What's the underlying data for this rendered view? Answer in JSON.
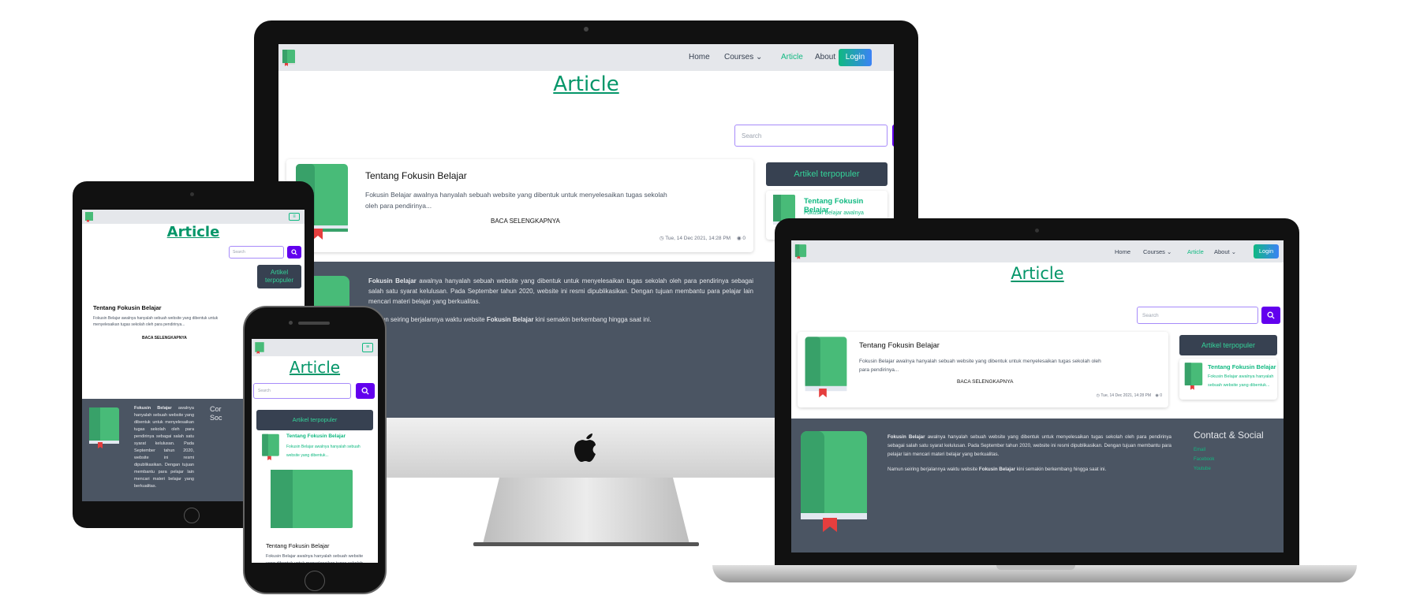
{
  "nav": {
    "home": "Home",
    "courses": "Courses",
    "article": "Article",
    "about": "About",
    "login": "Login"
  },
  "page_title": "Article",
  "search": {
    "placeholder": "Search"
  },
  "article_card": {
    "title": "Tentang Fokusin Belajar",
    "excerpt": "Fokusin Belajar awalnya hanyalah sebuah website yang dibentuk untuk menyelesaikan tugas sekolah oleh para pendirinya...",
    "read_more": "BACA SELENGKAPNYA",
    "date": "Tue, 14 Dec 2021, 14:28 PM",
    "views": "0"
  },
  "popular": {
    "heading": "Artikel terpopuler",
    "item_title": "Tentang Fokusin Belajar",
    "item_excerpt": "Fokusin Belajar awalnya hanyalah sebuah website yang dibentuk..."
  },
  "footer": {
    "brand": "Fokusin Belajar",
    "p1_rest": "awalnya hanyalah sebuah website yang dibentuk untuk menyelesaikan tugas sekolah oleh para pendirinya sebagai salah satu syarat kelulusan. Pada September tahun 2020, website ini resmi dipublikasikan. Dengan tujuan membantu para pelajar lain mencari materi belajar yang berkualitas.",
    "p2_start": "Namun seiring berjalannya waktu website",
    "p2_brand": "Fokusin Belajar",
    "p2_end": "kini semakin berkembang hingga saat ini.",
    "contact_title": "Contact & Social",
    "contact_title_short": "Cor Soc",
    "links": [
      "Email",
      "Facebook",
      "Youtube"
    ]
  },
  "colors": {
    "accent": "#10b981",
    "search_button": "#6200ee",
    "footer_bg": "#4b5563",
    "nav_bg": "#e5e7eb"
  }
}
